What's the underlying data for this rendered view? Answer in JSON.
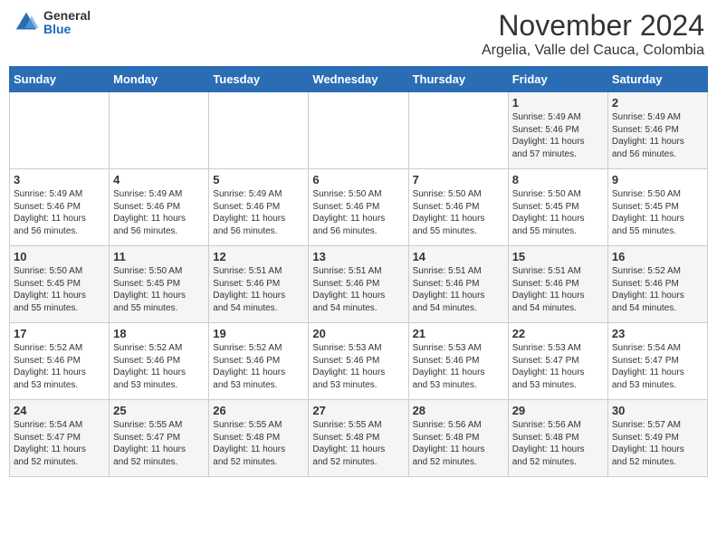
{
  "header": {
    "logo_general": "General",
    "logo_blue": "Blue",
    "month_title": "November 2024",
    "location": "Argelia, Valle del Cauca, Colombia"
  },
  "weekdays": [
    "Sunday",
    "Monday",
    "Tuesday",
    "Wednesday",
    "Thursday",
    "Friday",
    "Saturday"
  ],
  "weeks": [
    [
      {
        "day": "",
        "info": ""
      },
      {
        "day": "",
        "info": ""
      },
      {
        "day": "",
        "info": ""
      },
      {
        "day": "",
        "info": ""
      },
      {
        "day": "",
        "info": ""
      },
      {
        "day": "1",
        "info": "Sunrise: 5:49 AM\nSunset: 5:46 PM\nDaylight: 11 hours\nand 57 minutes."
      },
      {
        "day": "2",
        "info": "Sunrise: 5:49 AM\nSunset: 5:46 PM\nDaylight: 11 hours\nand 56 minutes."
      }
    ],
    [
      {
        "day": "3",
        "info": "Sunrise: 5:49 AM\nSunset: 5:46 PM\nDaylight: 11 hours\nand 56 minutes."
      },
      {
        "day": "4",
        "info": "Sunrise: 5:49 AM\nSunset: 5:46 PM\nDaylight: 11 hours\nand 56 minutes."
      },
      {
        "day": "5",
        "info": "Sunrise: 5:49 AM\nSunset: 5:46 PM\nDaylight: 11 hours\nand 56 minutes."
      },
      {
        "day": "6",
        "info": "Sunrise: 5:50 AM\nSunset: 5:46 PM\nDaylight: 11 hours\nand 56 minutes."
      },
      {
        "day": "7",
        "info": "Sunrise: 5:50 AM\nSunset: 5:46 PM\nDaylight: 11 hours\nand 55 minutes."
      },
      {
        "day": "8",
        "info": "Sunrise: 5:50 AM\nSunset: 5:45 PM\nDaylight: 11 hours\nand 55 minutes."
      },
      {
        "day": "9",
        "info": "Sunrise: 5:50 AM\nSunset: 5:45 PM\nDaylight: 11 hours\nand 55 minutes."
      }
    ],
    [
      {
        "day": "10",
        "info": "Sunrise: 5:50 AM\nSunset: 5:45 PM\nDaylight: 11 hours\nand 55 minutes."
      },
      {
        "day": "11",
        "info": "Sunrise: 5:50 AM\nSunset: 5:45 PM\nDaylight: 11 hours\nand 55 minutes."
      },
      {
        "day": "12",
        "info": "Sunrise: 5:51 AM\nSunset: 5:46 PM\nDaylight: 11 hours\nand 54 minutes."
      },
      {
        "day": "13",
        "info": "Sunrise: 5:51 AM\nSunset: 5:46 PM\nDaylight: 11 hours\nand 54 minutes."
      },
      {
        "day": "14",
        "info": "Sunrise: 5:51 AM\nSunset: 5:46 PM\nDaylight: 11 hours\nand 54 minutes."
      },
      {
        "day": "15",
        "info": "Sunrise: 5:51 AM\nSunset: 5:46 PM\nDaylight: 11 hours\nand 54 minutes."
      },
      {
        "day": "16",
        "info": "Sunrise: 5:52 AM\nSunset: 5:46 PM\nDaylight: 11 hours\nand 54 minutes."
      }
    ],
    [
      {
        "day": "17",
        "info": "Sunrise: 5:52 AM\nSunset: 5:46 PM\nDaylight: 11 hours\nand 53 minutes."
      },
      {
        "day": "18",
        "info": "Sunrise: 5:52 AM\nSunset: 5:46 PM\nDaylight: 11 hours\nand 53 minutes."
      },
      {
        "day": "19",
        "info": "Sunrise: 5:52 AM\nSunset: 5:46 PM\nDaylight: 11 hours\nand 53 minutes."
      },
      {
        "day": "20",
        "info": "Sunrise: 5:53 AM\nSunset: 5:46 PM\nDaylight: 11 hours\nand 53 minutes."
      },
      {
        "day": "21",
        "info": "Sunrise: 5:53 AM\nSunset: 5:46 PM\nDaylight: 11 hours\nand 53 minutes."
      },
      {
        "day": "22",
        "info": "Sunrise: 5:53 AM\nSunset: 5:47 PM\nDaylight: 11 hours\nand 53 minutes."
      },
      {
        "day": "23",
        "info": "Sunrise: 5:54 AM\nSunset: 5:47 PM\nDaylight: 11 hours\nand 53 minutes."
      }
    ],
    [
      {
        "day": "24",
        "info": "Sunrise: 5:54 AM\nSunset: 5:47 PM\nDaylight: 11 hours\nand 52 minutes."
      },
      {
        "day": "25",
        "info": "Sunrise: 5:55 AM\nSunset: 5:47 PM\nDaylight: 11 hours\nand 52 minutes."
      },
      {
        "day": "26",
        "info": "Sunrise: 5:55 AM\nSunset: 5:48 PM\nDaylight: 11 hours\nand 52 minutes."
      },
      {
        "day": "27",
        "info": "Sunrise: 5:55 AM\nSunset: 5:48 PM\nDaylight: 11 hours\nand 52 minutes."
      },
      {
        "day": "28",
        "info": "Sunrise: 5:56 AM\nSunset: 5:48 PM\nDaylight: 11 hours\nand 52 minutes."
      },
      {
        "day": "29",
        "info": "Sunrise: 5:56 AM\nSunset: 5:48 PM\nDaylight: 11 hours\nand 52 minutes."
      },
      {
        "day": "30",
        "info": "Sunrise: 5:57 AM\nSunset: 5:49 PM\nDaylight: 11 hours\nand 52 minutes."
      }
    ]
  ]
}
